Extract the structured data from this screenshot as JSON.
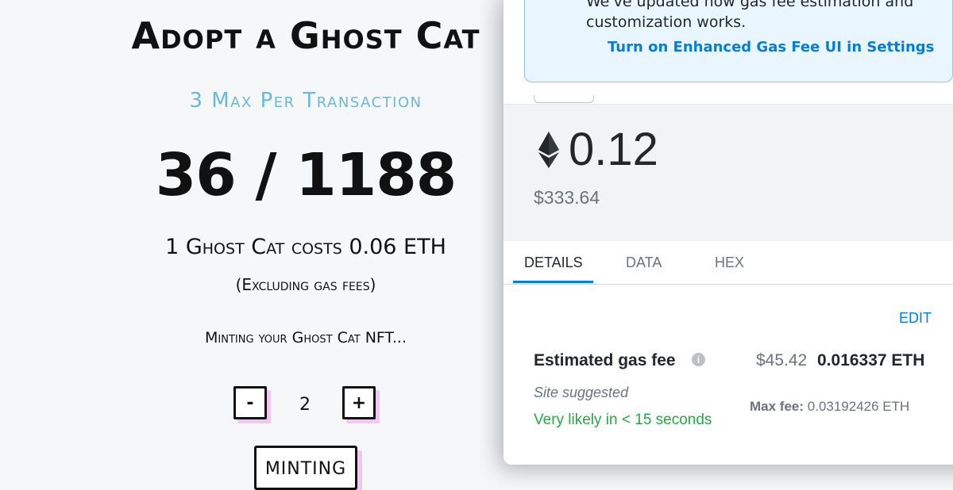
{
  "mint_page": {
    "title": "Adopt a Ghost Cat",
    "max_per_tx": "3 Max Per Transaction",
    "count": "36 / 1188",
    "cost": "1 Ghost Cat costs 0.06 ETH",
    "excluding": "(Excluding gas fees)",
    "status": "Minting your Ghost Cat NFT...",
    "minus_label": "-",
    "quantity": "2",
    "plus_label": "+",
    "mint_button_label": "MINTING"
  },
  "wallet": {
    "notice_text": "We've updated how gas fee estimation and customization works.",
    "notice_link": "Turn on Enhanced Gas Fee UI in Settings",
    "amount": "0.12",
    "fiat_amount": "$333.64",
    "tabs": [
      {
        "label": "DETAILS",
        "active": true
      },
      {
        "label": "DATA",
        "active": false
      },
      {
        "label": "HEX",
        "active": false
      }
    ],
    "edit_label": "EDIT",
    "gas_label": "Estimated gas fee",
    "gas_fiat": "$45.42",
    "gas_eth": "0.016337 ETH",
    "site_suggested": "Site suggested",
    "likelihood": "Very likely in < 15 seconds",
    "max_fee_label": "Max fee:",
    "max_fee_value": "0.03192426 ETH",
    "icons": [
      "ethereum-icon",
      "info-icon"
    ]
  },
  "colors": {
    "accent_blue": "#037dd6",
    "success_green": "#28a745",
    "subtitle_blue": "#6bb8d8",
    "button_shadow_pink": "#f2c6f2"
  }
}
